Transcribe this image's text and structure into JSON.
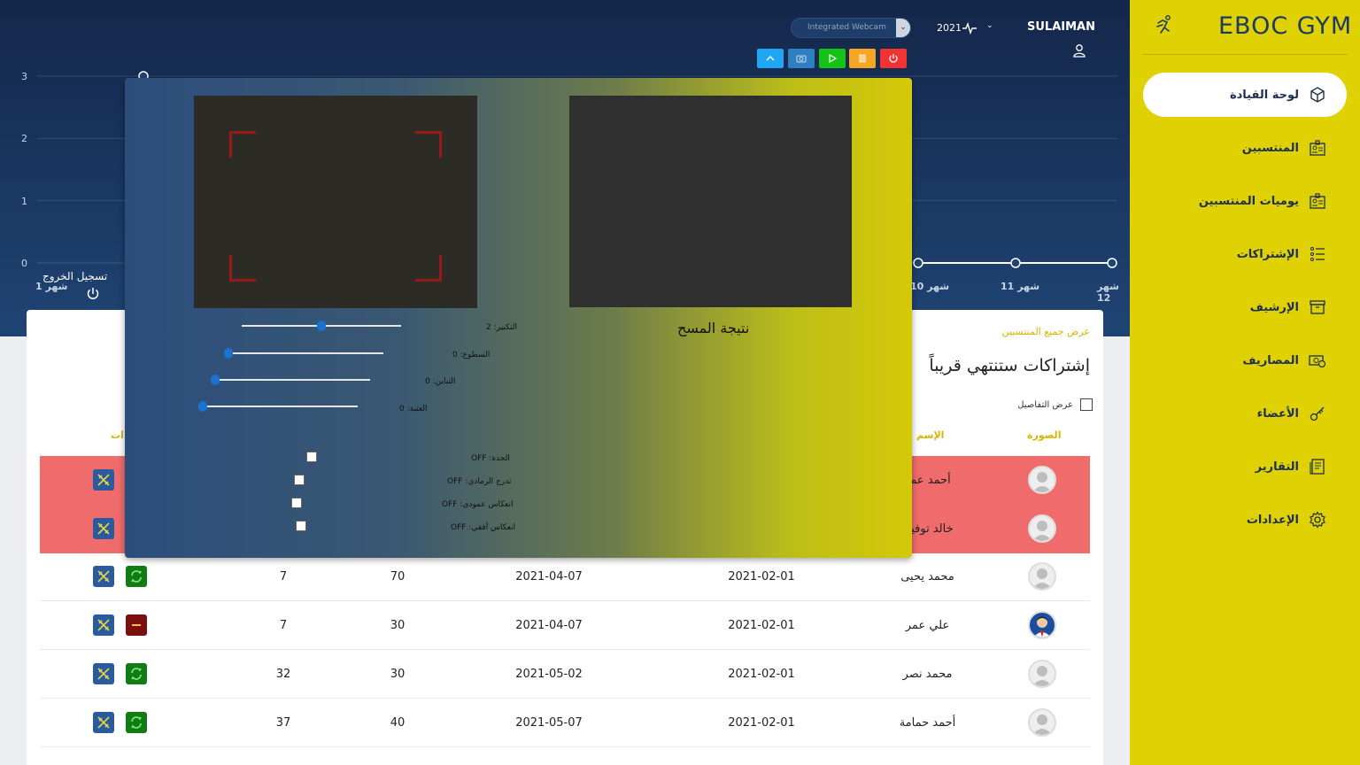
{
  "app": {
    "brand": "EBOC GYM",
    "user": "SULAIMAN",
    "year": "2021",
    "logout": "تسجيل الخروج"
  },
  "camera": {
    "device": "Integrated Webcam"
  },
  "nav": [
    {
      "label": "لوحة القيادة",
      "icon": "dashboard-cube-icon",
      "active": true
    },
    {
      "label": "المنتسبين",
      "icon": "members-card-icon"
    },
    {
      "label": "يوميات المنتسبين",
      "icon": "attendance-card-icon"
    },
    {
      "label": "الإشتراكات",
      "icon": "subscriptions-list-icon"
    },
    {
      "label": "الإرشيف",
      "icon": "archive-box-icon"
    },
    {
      "label": "المصاريف",
      "icon": "expenses-money-icon"
    },
    {
      "label": "الأعضاء",
      "icon": "users-key-icon"
    },
    {
      "label": "التقارير",
      "icon": "reports-document-icon"
    },
    {
      "label": "الإعدادات",
      "icon": "settings-gear-icon"
    }
  ],
  "chart_data": {
    "type": "line",
    "y_ticks": [
      "0",
      "1",
      "2",
      "3"
    ],
    "x_labels": [
      "شهر 1",
      "شهر 10",
      "شهر 11",
      "شهر 12"
    ],
    "ylim": [
      0,
      3
    ],
    "visible_points": [
      {
        "x": "شهر 10",
        "y": 0
      },
      {
        "x": "شهر 11",
        "y": 0
      },
      {
        "x": "شهر 12",
        "y": 0
      }
    ]
  },
  "card": {
    "show_all": "عرض جميع المنتسبين",
    "title": "إشتراكات ستنتهي قريباً",
    "details": "عرض التفاصيل",
    "col_photo": "الصورة",
    "col_name": "الإسم",
    "col_actions": "ات"
  },
  "rows": [
    {
      "name": "أحمد عمر",
      "start": "",
      "end": "",
      "price": "",
      "days": "",
      "highlight": true,
      "renew": "none",
      "avatar": "default"
    },
    {
      "name": "خالد توفيق",
      "start": "",
      "end": "",
      "price": "",
      "days": "",
      "highlight": true,
      "renew": "none",
      "avatar": "default"
    },
    {
      "name": "محمد يحيى",
      "start": "2021-02-01",
      "end": "2021-04-07",
      "price": "70",
      "days": "7",
      "highlight": false,
      "renew": "green",
      "avatar": "default"
    },
    {
      "name": "علي عمر",
      "start": "2021-02-01",
      "end": "2021-04-07",
      "price": "30",
      "days": "7",
      "highlight": false,
      "renew": "red",
      "avatar": "photo"
    },
    {
      "name": "محمد نصر",
      "start": "2021-02-01",
      "end": "2021-05-02",
      "price": "30",
      "days": "32",
      "highlight": false,
      "renew": "green",
      "avatar": "default"
    },
    {
      "name": "أحمد حمامة",
      "start": "2021-02-01",
      "end": "2021-05-07",
      "price": "40",
      "days": "37",
      "highlight": false,
      "renew": "green",
      "avatar": "default"
    }
  ],
  "modal": {
    "result_label": "نتيجة المسح",
    "sliders": [
      {
        "label": "التكبير: 2",
        "value": 0.5
      },
      {
        "label": "السطوع: 0",
        "value": 0.0
      },
      {
        "label": "التباين: 0",
        "value": 0.0
      },
      {
        "label": "العتبة: 0",
        "value": 0.0
      }
    ],
    "toggles": [
      {
        "label": "OFF :الحدة"
      },
      {
        "label": "OFF :تدرج الرمادي"
      },
      {
        "label": "OFF :انعكاس عمودي"
      },
      {
        "label": "OFF :انعكاس أفقي"
      }
    ]
  }
}
